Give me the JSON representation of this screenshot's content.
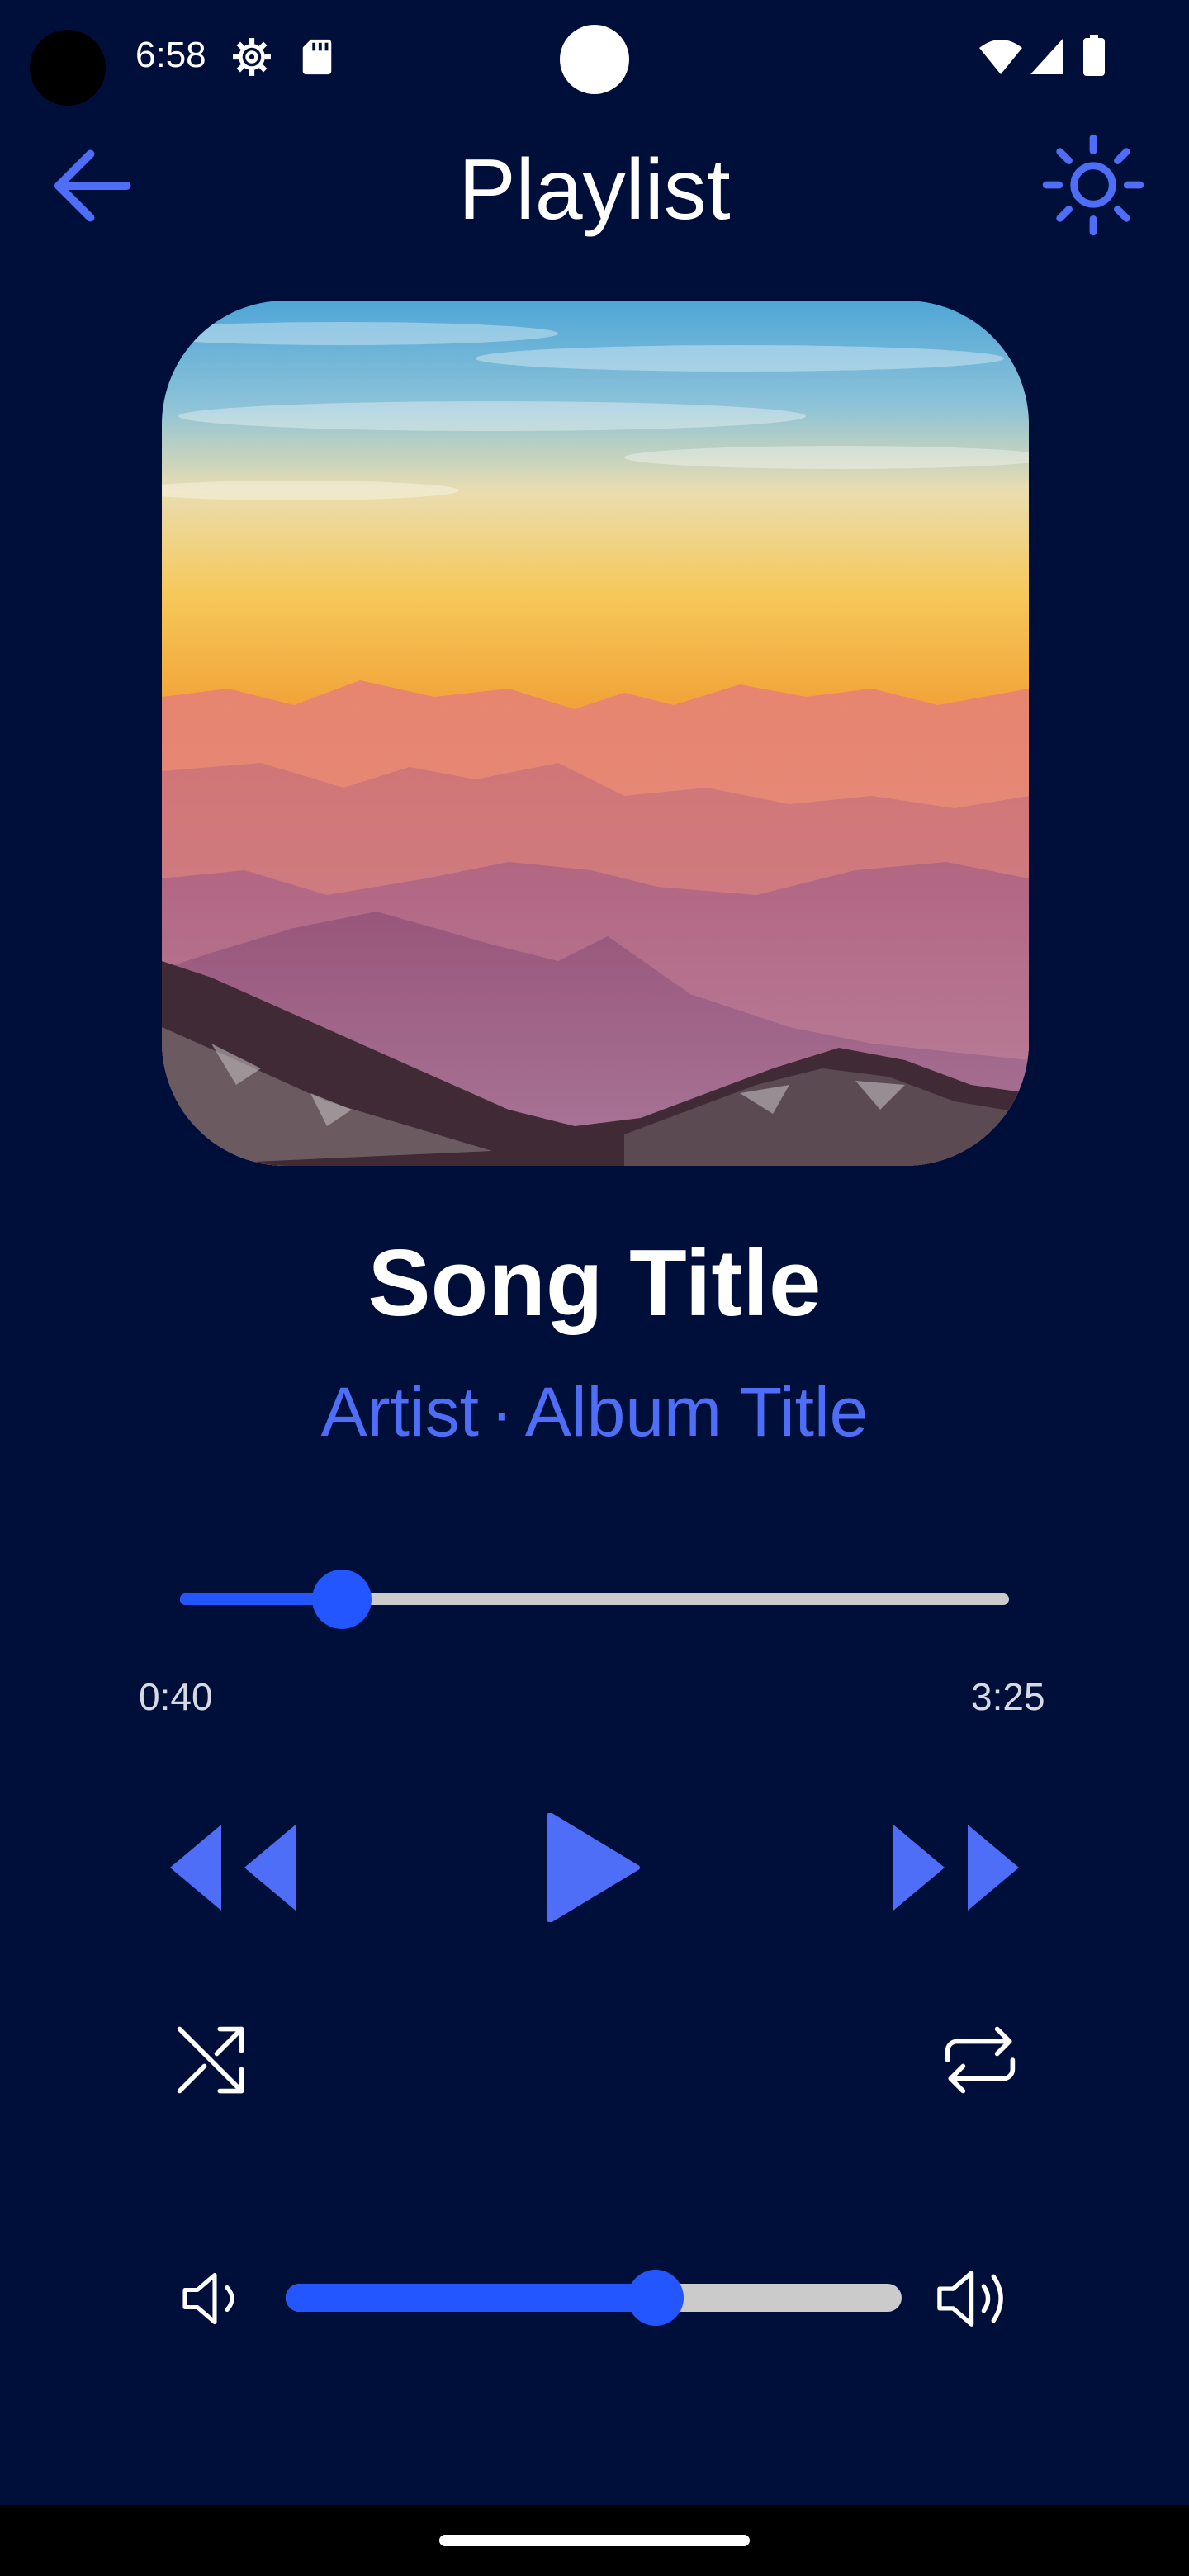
{
  "status_bar": {
    "time": "6:58",
    "icons": [
      "gear-icon",
      "sd-card-icon",
      "wifi-icon",
      "signal-icon",
      "battery-icon"
    ]
  },
  "app_bar": {
    "title": "Playlist",
    "back_icon": "arrow-left-icon",
    "theme_icon": "sun-icon"
  },
  "track": {
    "title": "Song Title",
    "artist": "Artist",
    "separator": "·",
    "album": "Album Title"
  },
  "progress": {
    "elapsed": "0:40",
    "total": "3:25",
    "fraction": 0.195
  },
  "controls": {
    "rewind_icon": "rewind-icon",
    "play_icon": "play-icon",
    "forward_icon": "fast-forward-icon",
    "shuffle_icon": "shuffle-icon",
    "repeat_icon": "repeat-icon"
  },
  "volume": {
    "fraction": 0.6,
    "low_icon": "volume-low-icon",
    "high_icon": "volume-high-icon"
  },
  "colors": {
    "background": "#000f3a",
    "accent": "#2456ff",
    "accent_text": "#4f6ef7",
    "track": "#cbcbcb",
    "secondary_text": "#d7d9e2"
  }
}
